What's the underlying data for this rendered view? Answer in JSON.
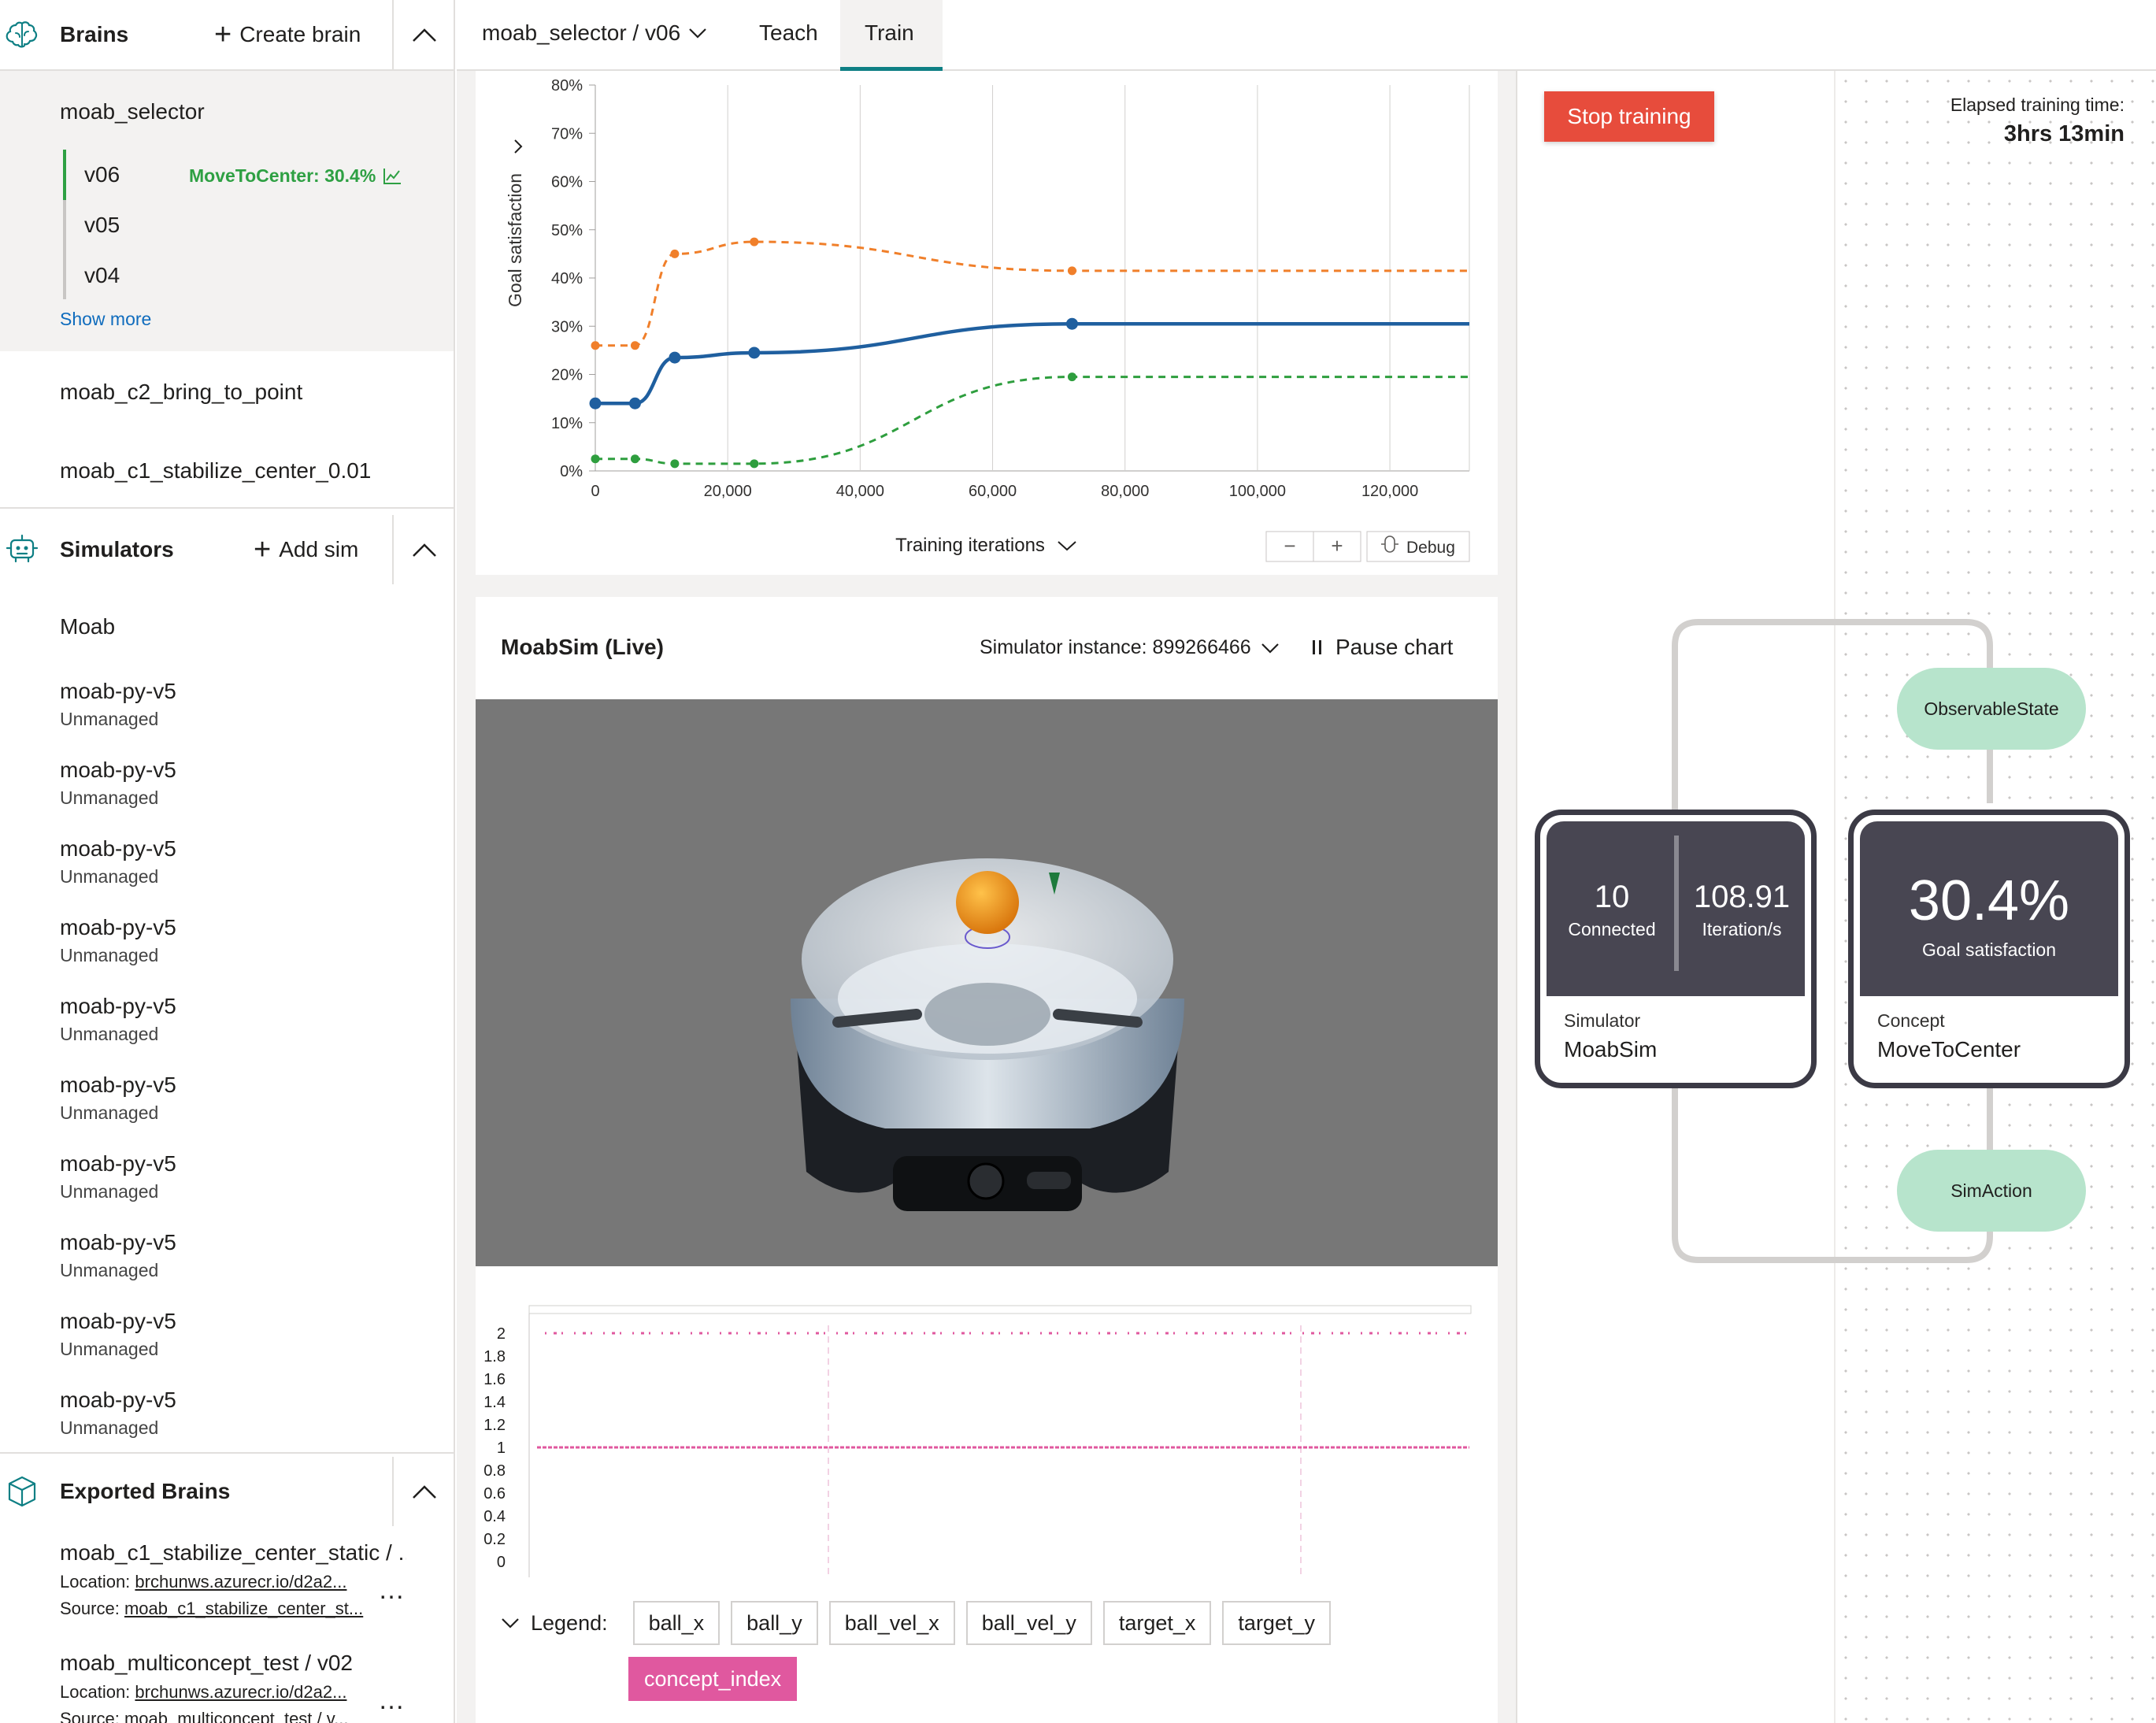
{
  "sidebar": {
    "brains": {
      "title": "Brains",
      "create_label": "Create brain",
      "selected_brain": "moab_selector",
      "versions": [
        {
          "label": "v06",
          "metric": "MoveToCenter: 30.4%"
        },
        {
          "label": "v05"
        },
        {
          "label": "v04"
        }
      ],
      "show_more": "Show more",
      "others": [
        "moab_c2_bring_to_point",
        "moab_c1_stabilize_center_0.01"
      ]
    },
    "simulators": {
      "title": "Simulators",
      "add_label": "Add sim",
      "first": "Moab",
      "items": [
        {
          "name": "moab-py-v5",
          "status": "Unmanaged"
        },
        {
          "name": "moab-py-v5",
          "status": "Unmanaged"
        },
        {
          "name": "moab-py-v5",
          "status": "Unmanaged"
        },
        {
          "name": "moab-py-v5",
          "status": "Unmanaged"
        },
        {
          "name": "moab-py-v5",
          "status": "Unmanaged"
        },
        {
          "name": "moab-py-v5",
          "status": "Unmanaged"
        },
        {
          "name": "moab-py-v5",
          "status": "Unmanaged"
        },
        {
          "name": "moab-py-v5",
          "status": "Unmanaged"
        },
        {
          "name": "moab-py-v5",
          "status": "Unmanaged"
        },
        {
          "name": "moab-py-v5",
          "status": "Unmanaged"
        }
      ]
    },
    "exported": {
      "title": "Exported Brains",
      "items": [
        {
          "name": "moab_c1_stabilize_center_static / ...",
          "location_label": "Location:",
          "location": "brchunws.azurecr.io/d2a2...",
          "source_label": "Source:",
          "source": "moab_c1_stabilize_center_st..."
        },
        {
          "name": "moab_multiconcept_test / v02",
          "location_label": "Location:",
          "location": "brchunws.azurecr.io/d2a2...",
          "source_label": "Source:",
          "source": "moab_multiconcept_test / v..."
        }
      ]
    }
  },
  "topbar": {
    "breadcrumb": "moab_selector / v06",
    "tabs": [
      "Teach",
      "Train"
    ],
    "active_tab": "Train"
  },
  "goal_chart": {
    "ylabel": "Goal satisfaction",
    "xlabel": "Training iterations",
    "debug_label": "Debug",
    "zoom_out": "−",
    "zoom_in": "+"
  },
  "chart_data": [
    {
      "type": "line",
      "ylabel": "Goal satisfaction",
      "xlabel": "Training iterations",
      "ylim": [
        0,
        80
      ],
      "xlim": [
        0,
        132000
      ],
      "y_ticks": [
        "0%",
        "10%",
        "20%",
        "30%",
        "40%",
        "50%",
        "60%",
        "70%",
        "80%"
      ],
      "x_ticks": [
        "0",
        "20,000",
        "40,000",
        "60,000",
        "80,000",
        "100,000",
        "120,000"
      ],
      "x_tick_values": [
        0,
        20000,
        40000,
        60000,
        80000,
        100000,
        120000
      ],
      "series": [
        {
          "color": "#f07f2a",
          "dashed": true,
          "points": [
            [
              0,
              26
            ],
            [
              6000,
              26
            ],
            [
              12000,
              45
            ],
            [
              24000,
              47.5
            ],
            [
              72000,
              41.5
            ],
            [
              132000,
              41.5
            ]
          ],
          "markers": [
            0,
            1,
            2,
            3,
            4
          ]
        },
        {
          "color": "#1f5f9f",
          "dashed": false,
          "points": [
            [
              0,
              14
            ],
            [
              6000,
              14
            ],
            [
              12000,
              23.5
            ],
            [
              24000,
              24.5
            ],
            [
              72000,
              30.5
            ],
            [
              132000,
              30.5
            ]
          ],
          "markers": [
            0,
            1,
            2,
            3,
            4
          ]
        },
        {
          "color": "#2e9e3e",
          "dashed": true,
          "points": [
            [
              0,
              2.5
            ],
            [
              6000,
              2.5
            ],
            [
              12000,
              1.5
            ],
            [
              24000,
              1.5
            ],
            [
              72000,
              19.5
            ],
            [
              132000,
              19.5
            ]
          ],
          "markers": [
            0,
            1,
            2,
            3,
            4
          ]
        }
      ]
    },
    {
      "type": "scatter",
      "ylim": [
        0,
        2
      ],
      "y_ticks": [
        "2",
        "1.8",
        "1.6",
        "1.4",
        "1.2",
        "1",
        "0.8",
        "0.6",
        "0.4",
        "0.2",
        "0"
      ],
      "series": [
        {
          "name": "concept_index",
          "color": "#e0589f",
          "levels": [
            1,
            2
          ]
        }
      ]
    }
  ],
  "sim_panel": {
    "title": "MoabSim (Live)",
    "instance_label": "Simulator instance: 899266466",
    "pause_label": "Pause chart",
    "legend_label": "Legend:",
    "legend_items": [
      "ball_x",
      "ball_y",
      "ball_vel_x",
      "ball_vel_y",
      "target_x",
      "target_y",
      "concept_index"
    ],
    "legend_active": "concept_index"
  },
  "graph_panel": {
    "stop_label": "Stop training",
    "elapsed_label": "Elapsed training time:",
    "elapsed_value": "3hrs 13min",
    "simulator_node": {
      "connected": "10",
      "connected_label": "Connected",
      "rate": "108.91",
      "rate_label": "Iteration/s",
      "type": "Simulator",
      "name": "MoabSim"
    },
    "concept_node": {
      "value": "30.4%",
      "value_label": "Goal satisfaction",
      "type": "Concept",
      "name": "MoveToCenter"
    },
    "observable": "ObservableState",
    "action": "SimAction"
  },
  "colors": {
    "accent": "#0e7f84",
    "stop": "#e74c3c",
    "pill": "#b7e4cc",
    "node": "#484652",
    "concept_index": "#e0589f"
  }
}
